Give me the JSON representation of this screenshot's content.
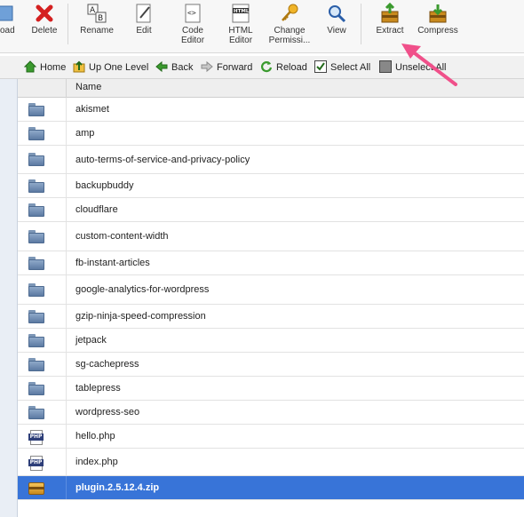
{
  "toolbar": {
    "buttons": [
      {
        "label": "oad",
        "icon": "upload-icon"
      },
      {
        "label": "Delete",
        "icon": "delete-x-icon"
      },
      {
        "label": "Rename",
        "icon": "rename-icon"
      },
      {
        "label": "Edit",
        "icon": "edit-pencil-icon"
      },
      {
        "label": "Code\nEditor",
        "icon": "code-editor-icon"
      },
      {
        "label": "HTML\nEditor",
        "icon": "html-editor-icon"
      },
      {
        "label": "Change\nPermissi...",
        "icon": "key-icon"
      },
      {
        "label": "View",
        "icon": "magnifier-icon"
      },
      {
        "label": "Extract",
        "icon": "extract-icon"
      },
      {
        "label": "Compress",
        "icon": "compress-icon"
      }
    ],
    "html_icon_text": "HTML",
    "code_icon_text": "<>"
  },
  "nav": {
    "home": "Home",
    "up": "Up One Level",
    "back": "Back",
    "forward": "Forward",
    "reload": "Reload",
    "select_all": "Select All",
    "unselect_all": "Unselect All"
  },
  "table": {
    "header_name": "Name",
    "rows": [
      {
        "name": "akismet",
        "type": "folder"
      },
      {
        "name": "amp",
        "type": "folder"
      },
      {
        "name": "auto-terms-of-service-and-privacy-policy",
        "type": "folder"
      },
      {
        "name": "backupbuddy",
        "type": "folder"
      },
      {
        "name": "cloudflare",
        "type": "folder"
      },
      {
        "name": "custom-content-width",
        "type": "folder"
      },
      {
        "name": "fb-instant-articles",
        "type": "folder"
      },
      {
        "name": "google-analytics-for-wordpress",
        "type": "folder"
      },
      {
        "name": "gzip-ninja-speed-compression",
        "type": "folder"
      },
      {
        "name": "jetpack",
        "type": "folder"
      },
      {
        "name": "sg-cachepress",
        "type": "folder"
      },
      {
        "name": "tablepress",
        "type": "folder"
      },
      {
        "name": "wordpress-seo",
        "type": "folder"
      },
      {
        "name": "hello.php",
        "type": "php"
      },
      {
        "name": "index.php",
        "type": "php"
      },
      {
        "name": "plugin.2.5.12.4.zip",
        "type": "zip",
        "selected": true
      }
    ],
    "php_icon_text": "PHP"
  },
  "colors": {
    "selection": "#3874d8",
    "annotation_arrow": "#f0508a"
  }
}
